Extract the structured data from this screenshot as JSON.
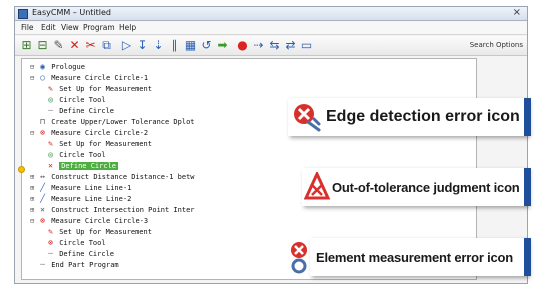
{
  "window": {
    "title": "EasyCMM – Untitled",
    "menu": [
      "File",
      "Edit",
      "View",
      "Program",
      "Help"
    ],
    "search_label": "Search Options"
  },
  "tree": [
    {
      "icon": "folder",
      "text": "Prologue",
      "indent": 1
    },
    {
      "icon": "circle",
      "text": "Measure Circle Circle-1",
      "indent": 1
    },
    {
      "icon": "setup",
      "text": "Set Up for Measurement",
      "indent": 2
    },
    {
      "icon": "tool",
      "text": "Circle Tool",
      "indent": 2
    },
    {
      "icon": "define",
      "text": "Define Circle",
      "indent": 2
    },
    {
      "icon": "tolerance",
      "text": "Create Upper/Lower Tolerance Dplot",
      "indent": 1
    },
    {
      "icon": "circle",
      "text": "Measure Circle Circle-2",
      "indent": 1
    },
    {
      "icon": "setup",
      "text": "Set Up for Measurement",
      "indent": 2
    },
    {
      "icon": "tool",
      "text": "Circle Tool",
      "indent": 2
    },
    {
      "icon": "define",
      "text": "Define Circle",
      "indent": 2,
      "selected": true
    },
    {
      "icon": "distance",
      "text": "Construct Distance Distance-1 betw",
      "indent": 1
    },
    {
      "icon": "line",
      "text": "Measure Line Line-1",
      "indent": 1
    },
    {
      "icon": "line",
      "text": "Measure Line Line-2",
      "indent": 1
    },
    {
      "icon": "intersection",
      "text": "Construct Intersection Point Inter",
      "indent": 1
    },
    {
      "icon": "circle",
      "text": "Measure Circle Circle-3",
      "indent": 1
    },
    {
      "icon": "setup",
      "text": "Set Up for Measurement",
      "indent": 2
    },
    {
      "icon": "tool",
      "text": "Circle Tool",
      "indent": 2
    },
    {
      "icon": "define",
      "text": "Define Circle",
      "indent": 2
    },
    {
      "icon": "end",
      "text": "End Part Program",
      "indent": 1
    }
  ],
  "callouts": {
    "edge": "Edge detection error icon",
    "tolerance": "Out-of-tolerance judgment icon",
    "element": "Element measurement error icon"
  },
  "colors": {
    "callout_bar": "#1f4e9b",
    "selection": "#4caf3f",
    "error_red": "#d9302c"
  }
}
